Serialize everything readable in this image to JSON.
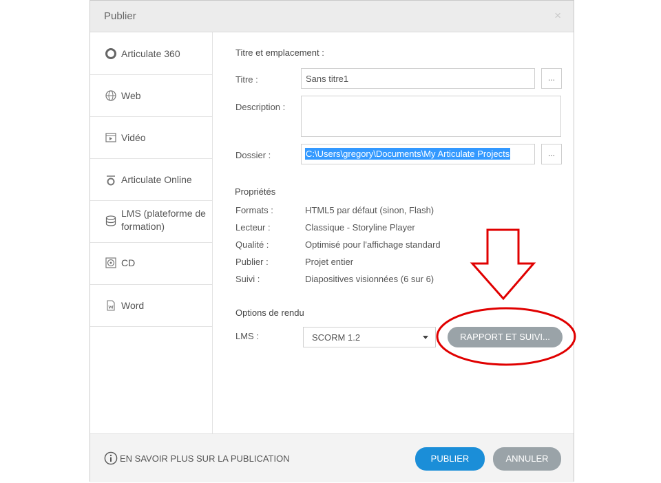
{
  "dialog": {
    "title": "Publier",
    "close_glyph": "×"
  },
  "sidebar": {
    "items": [
      {
        "label": "Articulate 360",
        "icon": "articulate-360-icon"
      },
      {
        "label": "Web",
        "icon": "globe-icon"
      },
      {
        "label": "Vidéo",
        "icon": "video-icon"
      },
      {
        "label": "Articulate Online",
        "icon": "articulate-online-icon"
      },
      {
        "label": "LMS (plateforme de formation)",
        "icon": "database-icon"
      },
      {
        "label": "CD",
        "icon": "disc-icon"
      },
      {
        "label": "Word",
        "icon": "word-document-icon"
      }
    ],
    "selected": "LMS (plateforme de formation)"
  },
  "title_section": {
    "heading": "Titre et emplacement :",
    "title_label": "Titre :",
    "title_value": "Sans titre1",
    "description_label": "Description :",
    "description_value": "",
    "folder_label": "Dossier :",
    "folder_value": "C:\\Users\\gregory\\Documents\\My Articulate Projects",
    "browse_label": "..."
  },
  "properties": {
    "heading": "Propriétés",
    "rows": [
      {
        "label": "Formats :",
        "value": "HTML5 par défaut (sinon, Flash)"
      },
      {
        "label": "Lecteur :",
        "value": "Classique - Storyline Player"
      },
      {
        "label": "Qualité :",
        "value": "Optimisé pour l'affichage standard"
      },
      {
        "label": "Publier :",
        "value": "Projet entier"
      },
      {
        "label": "Suivi :",
        "value": "Diapositives visionnées (6 sur 6)"
      }
    ]
  },
  "render_options": {
    "heading": "Options de rendu",
    "lms_label": "LMS :",
    "lms_value": "SCORM 1.2",
    "report_button": "RAPPORT ET SUIVI..."
  },
  "footer": {
    "learn_more": "EN SAVOIR PLUS SUR LA PUBLICATION",
    "publish": "PUBLIER",
    "cancel": "ANNULER"
  },
  "colors": {
    "publish": "#1b8ed8",
    "secondary": "#9aa3a8",
    "annotation": "#e00000",
    "selection": "#3399ff"
  }
}
